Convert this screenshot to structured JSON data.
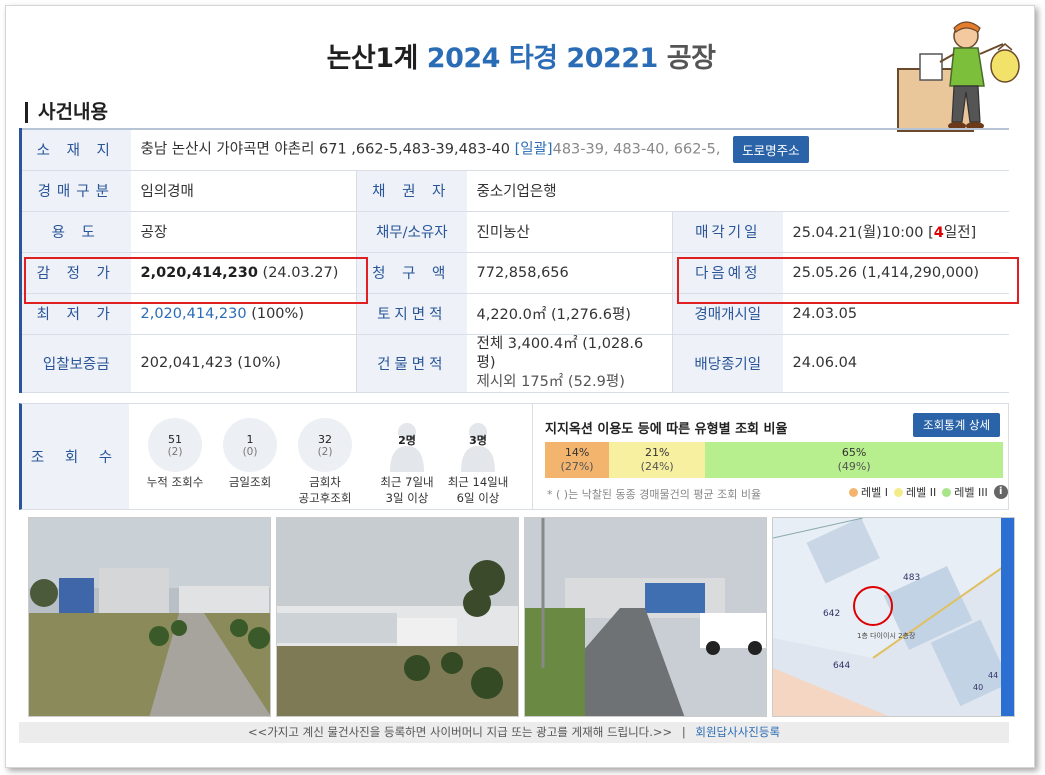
{
  "header": {
    "court": "논산1계",
    "case_no": "2024 타경 20221",
    "kind": "공장"
  },
  "section": {
    "title": "사건내용"
  },
  "info": {
    "location_label": "소 재 지",
    "location_value": "충남 논산시 가야곡면 야촌리 671 ,662-5,483-39,483-40",
    "location_ilgwal": "[일괄]",
    "location_extra": "483-39, 483-40, 662-5,",
    "road_button": "도로명주소",
    "auction_type_label": "경매구분",
    "auction_type_value": "임의경매",
    "creditor_label": "채 권 자",
    "creditor_value": "중소기업은행",
    "use_label": "용 도",
    "use_value": "공장",
    "debtor_label": "채무/소유자",
    "debtor_value": "진미농산",
    "sale_date_label": "매각기일",
    "sale_date_value": "25.04.21(월)10:00 [",
    "sale_date_days": "4",
    "sale_date_suffix": "일전]",
    "appraisal_label": "감 정 가",
    "appraisal_value": "2,020,414,230",
    "appraisal_date": "(24.03.27)",
    "claim_label": "청 구 액",
    "claim_value": "772,858,656",
    "next_label": "다음예정",
    "next_value": "25.05.26 (1,414,290,000)",
    "min_label": "최 저 가",
    "min_value": "2,020,414,230",
    "min_pct": "(100%)",
    "land_label": "토지면적",
    "land_value": "4,220.0㎡ (1,276.6평)",
    "start_label": "경매개시일",
    "start_value": "24.03.05",
    "deposit_label": "입찰보증금",
    "deposit_value": "202,041,423 (10%)",
    "building_label": "건물면적",
    "building_value": "전체 3,400.4㎡ (1,028.6평)",
    "building_value2": "제시외 175㎡ (52.9평)",
    "dividend_label": "배당종기일",
    "dividend_value": "24.06.04"
  },
  "views": {
    "label": "조 회 수",
    "stats": [
      {
        "main": "51",
        "sub": "(2)",
        "caption": "누적 조회수",
        "caption2": ""
      },
      {
        "main": "1",
        "sub": "(0)",
        "caption": "금일조회",
        "caption2": ""
      },
      {
        "main": "32",
        "sub": "(2)",
        "caption": "금회차",
        "caption2": "공고후조회"
      },
      {
        "main": "2명",
        "sub": "",
        "caption": "최근 7일내",
        "caption2": "3일 이상"
      },
      {
        "main": "3명",
        "sub": "",
        "caption": "최근 14일내",
        "caption2": "6일 이상"
      }
    ],
    "ratio_title": "지지옥션 이용도 등에 따른 유형별 조회 비율",
    "stat_button": "조회통계 상세",
    "segments": [
      {
        "pct": "14%",
        "avg": "(27%)",
        "share": 0.14,
        "color": "#f3b46e"
      },
      {
        "pct": "21%",
        "avg": "(24%)",
        "share": 0.21,
        "color": "#f7f0a0"
      },
      {
        "pct": "65%",
        "avg": "(49%)",
        "share": 0.65,
        "color": "#b7ee8e"
      }
    ],
    "note": "* ( )는 낙찰된 동종 경매물건의 평균 조회 비율",
    "legend": [
      {
        "label": "레벨 I",
        "color": "#f3b46e"
      },
      {
        "label": "레벨 II",
        "color": "#f3ec8a"
      },
      {
        "label": "레벨 III",
        "color": "#a8e48a"
      }
    ]
  },
  "caption": {
    "text": "<<가지고 계신 물건사진을 등록하면 사이버머니 지급 또는 광고를 게재해 드립니다.>>",
    "sep": "|",
    "link": "회원답사사진등록"
  },
  "map_labels": [
    "483",
    "642",
    "644",
    "44",
    "40",
    "1층 다이이시 2층장"
  ]
}
